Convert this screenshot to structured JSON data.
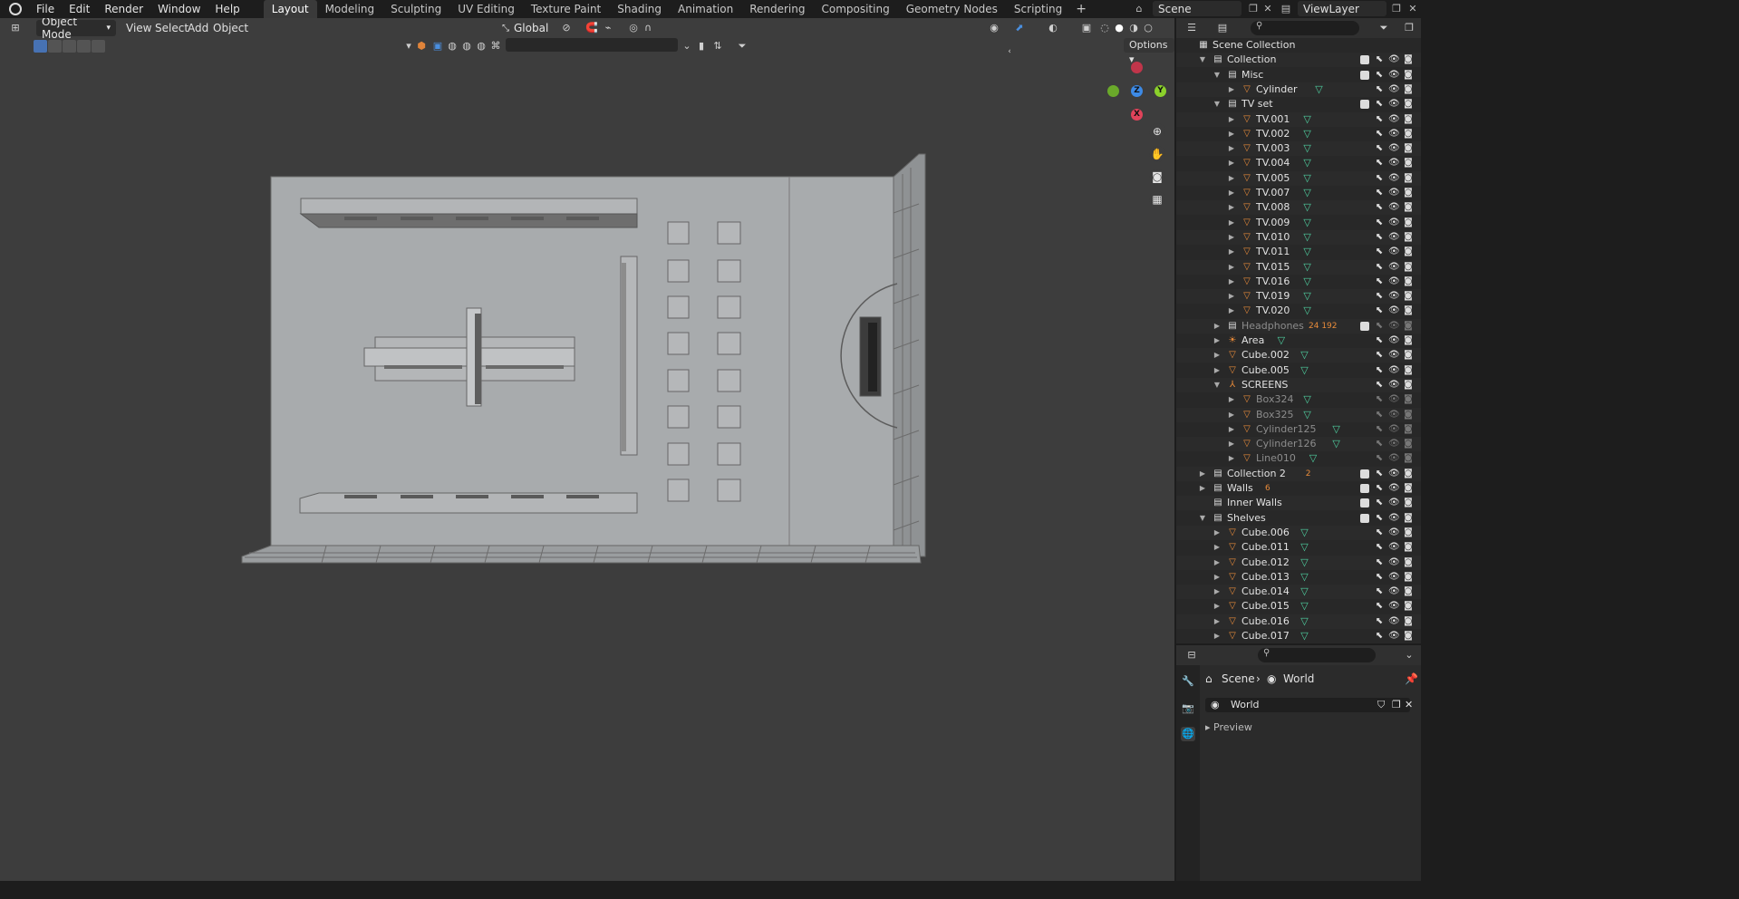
{
  "topbar": {
    "menus": [
      "File",
      "Edit",
      "Render",
      "Window",
      "Help"
    ],
    "workspaces": [
      "Layout",
      "Modeling",
      "Sculpting",
      "UV Editing",
      "Texture Paint",
      "Shading",
      "Animation",
      "Rendering",
      "Compositing",
      "Geometry Nodes",
      "Scripting"
    ],
    "active_workspace": "Layout",
    "add_tab": "+",
    "scene": "Scene",
    "view_layer": "ViewLayer"
  },
  "viewport": {
    "mode": "Object Mode",
    "menus": [
      "View",
      "Select",
      "Add",
      "Object"
    ],
    "transform_orientation": "Global",
    "options_label": "Options",
    "gizmo": {
      "x": "X",
      "y": "Y",
      "z": "Z"
    },
    "nav_icons": [
      "zoom-icon",
      "hand-icon",
      "camera-icon",
      "grid-icon"
    ]
  },
  "outliner": {
    "rows": [
      {
        "label": "Scene Collection",
        "type": "scene",
        "depth": 0,
        "open": null
      },
      {
        "label": "Collection",
        "type": "collection",
        "depth": 1,
        "open": true,
        "check": true
      },
      {
        "label": "Misc",
        "type": "collection",
        "depth": 2,
        "open": true,
        "check": true
      },
      {
        "label": "Cylinder",
        "type": "object",
        "depth": 3,
        "open": false,
        "mesh": true
      },
      {
        "label": "TV set",
        "type": "collection",
        "depth": 2,
        "open": true,
        "check": true
      },
      {
        "label": "TV.001",
        "type": "object",
        "depth": 3,
        "open": false,
        "mesh": true
      },
      {
        "label": "TV.002",
        "type": "object",
        "depth": 3,
        "open": false,
        "mesh": true
      },
      {
        "label": "TV.003",
        "type": "object",
        "depth": 3,
        "open": false,
        "mesh": true
      },
      {
        "label": "TV.004",
        "type": "object",
        "depth": 3,
        "open": false,
        "mesh": true
      },
      {
        "label": "TV.005",
        "type": "object",
        "depth": 3,
        "open": false,
        "mesh": true
      },
      {
        "label": "TV.007",
        "type": "object",
        "depth": 3,
        "open": false,
        "mesh": true
      },
      {
        "label": "TV.008",
        "type": "object",
        "depth": 3,
        "open": false,
        "mesh": true
      },
      {
        "label": "TV.009",
        "type": "object",
        "depth": 3,
        "open": false,
        "mesh": true
      },
      {
        "label": "TV.010",
        "type": "object",
        "depth": 3,
        "open": false,
        "mesh": true
      },
      {
        "label": "TV.011",
        "type": "object",
        "depth": 3,
        "open": false,
        "mesh": true
      },
      {
        "label": "TV.015",
        "type": "object",
        "depth": 3,
        "open": false,
        "mesh": true
      },
      {
        "label": "TV.016",
        "type": "object",
        "depth": 3,
        "open": false,
        "mesh": true
      },
      {
        "label": "TV.019",
        "type": "object",
        "depth": 3,
        "open": false,
        "mesh": true
      },
      {
        "label": "TV.020",
        "type": "object",
        "depth": 3,
        "open": false,
        "mesh": true
      },
      {
        "label": "Headphones",
        "type": "collection",
        "depth": 2,
        "open": false,
        "check": true,
        "dim": true,
        "badge": "24 192"
      },
      {
        "label": "Area",
        "type": "light",
        "depth": 2,
        "open": false,
        "mesh": true
      },
      {
        "label": "Cube.002",
        "type": "object",
        "depth": 2,
        "open": false,
        "mesh": true
      },
      {
        "label": "Cube.005",
        "type": "object",
        "depth": 2,
        "open": false,
        "mesh": true
      },
      {
        "label": "SCREENS",
        "type": "empty",
        "depth": 2,
        "open": true
      },
      {
        "label": "Box324",
        "type": "object",
        "depth": 3,
        "open": false,
        "mesh": true,
        "dim": true
      },
      {
        "label": "Box325",
        "type": "object",
        "depth": 3,
        "open": false,
        "mesh": true,
        "dim": true
      },
      {
        "label": "Cylinder125",
        "type": "object",
        "depth": 3,
        "open": false,
        "mesh": true,
        "dim": true
      },
      {
        "label": "Cylinder126",
        "type": "object",
        "depth": 3,
        "open": false,
        "mesh": true,
        "dim": true
      },
      {
        "label": "Line010",
        "type": "object",
        "depth": 3,
        "open": false,
        "mesh": true,
        "dim": true
      },
      {
        "label": "Collection 2",
        "type": "collection",
        "depth": 1,
        "open": false,
        "check": true,
        "badge": "2"
      },
      {
        "label": "Walls",
        "type": "collection",
        "depth": 1,
        "open": false,
        "check": true,
        "badge": "6"
      },
      {
        "label": "Inner Walls",
        "type": "collection",
        "depth": 1,
        "open": null,
        "check": true
      },
      {
        "label": "Shelves",
        "type": "collection",
        "depth": 1,
        "open": true,
        "check": true
      },
      {
        "label": "Cube.006",
        "type": "object",
        "depth": 2,
        "open": false,
        "mesh": true
      },
      {
        "label": "Cube.011",
        "type": "object",
        "depth": 2,
        "open": false,
        "mesh": true
      },
      {
        "label": "Cube.012",
        "type": "object",
        "depth": 2,
        "open": false,
        "mesh": true
      },
      {
        "label": "Cube.013",
        "type": "object",
        "depth": 2,
        "open": false,
        "mesh": true
      },
      {
        "label": "Cube.014",
        "type": "object",
        "depth": 2,
        "open": false,
        "mesh": true
      },
      {
        "label": "Cube.015",
        "type": "object",
        "depth": 2,
        "open": false,
        "mesh": true
      },
      {
        "label": "Cube.016",
        "type": "object",
        "depth": 2,
        "open": false,
        "mesh": true
      },
      {
        "label": "Cube.017",
        "type": "object",
        "depth": 2,
        "open": false,
        "mesh": true
      }
    ]
  },
  "properties": {
    "breadcrumb_scene": "Scene",
    "breadcrumb_world": "World",
    "world_name": "World",
    "section": "Preview"
  },
  "colors": {
    "accent": "#4772b3",
    "object_orange": "#e88b3a",
    "mesh_green": "#4fd0a0",
    "gizmo_x": "#e0435a",
    "gizmo_y": "#8bd12b",
    "gizmo_z": "#3d8ae6"
  }
}
